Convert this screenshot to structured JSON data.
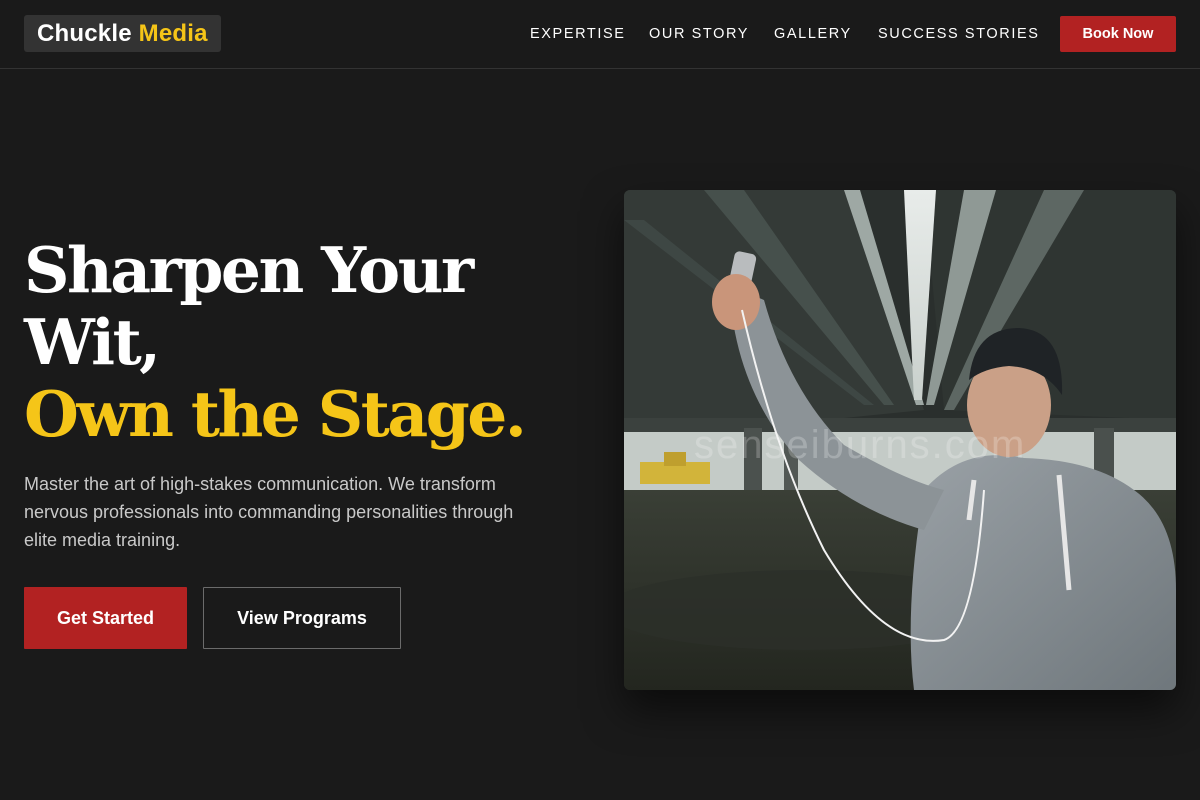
{
  "header": {
    "logo": {
      "part1": "Chuckle",
      "part2": "Media"
    },
    "nav": [
      {
        "label": "EXPERTISE"
      },
      {
        "label": "OUR STORY"
      },
      {
        "label": "GALLERY"
      },
      {
        "label": "SUCCESS STORIES"
      }
    ],
    "cta_label": "Book Now"
  },
  "hero": {
    "headline": {
      "line1": "Sharpen Your",
      "line2": "Wit,",
      "line3": "Own the Stage."
    },
    "description": "Master the art of high-stakes communication. We transform nervous professionals into commanding personalities through elite media training.",
    "primary_button": "Get Started",
    "secondary_button": "View Programs",
    "image": {
      "watermark": "senseiburns.com"
    }
  },
  "colors": {
    "background": "#1a1a1a",
    "accent_gold": "#f5c518",
    "accent_red": "#b22222"
  }
}
